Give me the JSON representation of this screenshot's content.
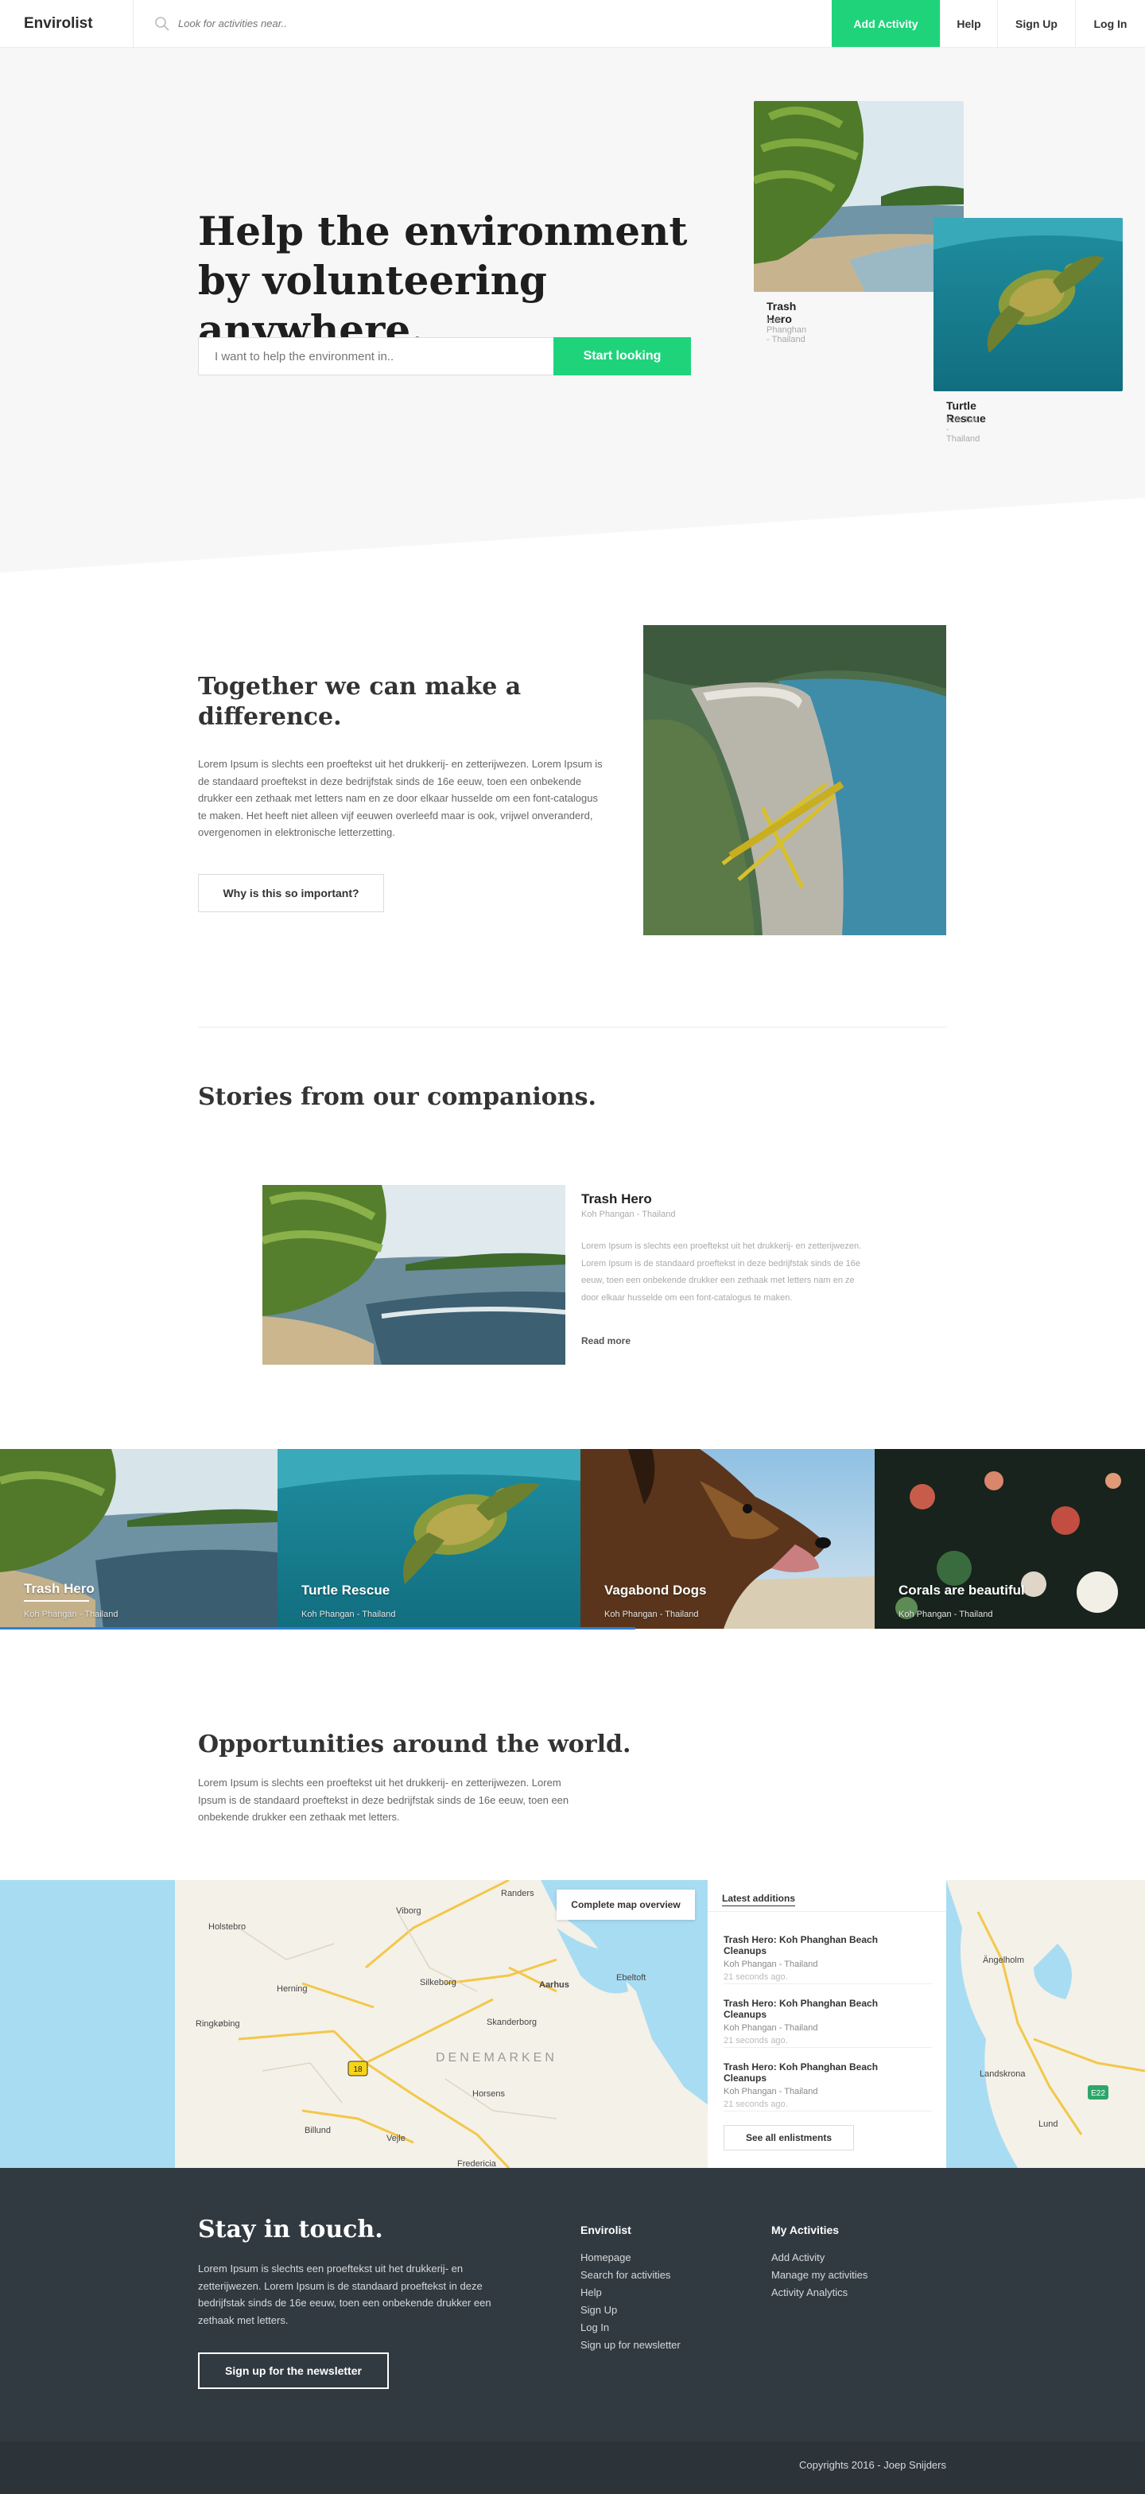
{
  "nav": {
    "brand": "Envirolist",
    "search_placeholder": "Look for activities near..",
    "add_activity": "Add Activity",
    "help": "Help",
    "sign_up": "Sign Up",
    "log_in": "Log In"
  },
  "hero": {
    "title": "Help the environment by volunteering anywhere.",
    "input_placeholder": "I want to help the environment in..",
    "button": "Start looking",
    "cards": [
      {
        "title": "Trash Hero",
        "location": "Koh Phanghan - Thailand"
      },
      {
        "title": "Turtle Rescue",
        "location": "Koh Tao - Thailand"
      }
    ]
  },
  "together": {
    "title": "Together we can make a difference.",
    "text": "Lorem Ipsum is slechts een proeftekst uit het drukkerij- en zetterijwezen. Lorem Ipsum is de standaard proeftekst in deze bedrijfstak sinds de 16e eeuw, toen een onbekende drukker een zethaak met letters nam en ze door elkaar husselde om een font-catalogus te maken. Het heeft niet alleen vijf eeuwen overleefd maar is ook, vrijwel onveranderd, overgenomen in elektronische letterzetting.",
    "button": "Why is this so important?"
  },
  "stories": {
    "title": "Stories from our companions.",
    "featured": {
      "title": "Trash Hero",
      "location": "Koh Phangan - Thailand",
      "text": "Lorem Ipsum is slechts een proeftekst uit het drukkerij- en zetterijwezen. Lorem Ipsum is de standaard proeftekst in deze bedrijfstak sinds de 16e eeuw, toen een onbekende drukker een zethaak met letters nam en ze door elkaar husselde om een font-catalogus te maken.",
      "read_more": "Read more"
    },
    "tiles": [
      {
        "title": "Trash Hero",
        "location": "Koh Phangan - Thailand"
      },
      {
        "title": "Turtle Rescue",
        "location": "Koh Phangan - Thailand"
      },
      {
        "title": "Vagabond Dogs",
        "location": "Koh Phangan - Thailand"
      },
      {
        "title": "Corals are beautiful",
        "location": "Koh Phangan - Thailand"
      }
    ]
  },
  "opportunities": {
    "title": "Opportunities around the world.",
    "text": "Lorem Ipsum is slechts een proeftekst uit het drukkerij- en zetterijwezen. Lorem Ipsum is de standaard proeftekst in deze bedrijfstak sinds de 16e eeuw, toen een onbekende drukker een zethaak met letters.",
    "map_button": "Complete map overview",
    "map_labels": {
      "randers": "Randers",
      "viborg": "Viborg",
      "holstebro": "Holstebro",
      "herning": "Herning",
      "silkeborg": "Silkeborg",
      "aarhus": "Aarhus",
      "ebeltoft": "Ebeltoft",
      "ringkobing": "Ringkøbing",
      "skanderborg": "Skanderborg",
      "denemarken": "DENEMARKEN",
      "horsens": "Horsens",
      "billund": "Billund",
      "vejle": "Vejle",
      "fredericia": "Fredericia",
      "road18": "18",
      "angelholm": "Ängelholm",
      "landskrona": "Landskrona",
      "lund": "Lund",
      "e22": "E22"
    },
    "latest": {
      "heading": "Latest additions",
      "items": [
        {
          "title": "Trash Hero: Koh Phanghan Beach Cleanups",
          "location": "Koh Phangan - Thailand",
          "time": "21 seconds ago."
        },
        {
          "title": "Trash Hero: Koh Phanghan Beach Cleanups",
          "location": "Koh Phangan - Thailand",
          "time": "21 seconds ago."
        },
        {
          "title": "Trash Hero: Koh Phanghan Beach Cleanups",
          "location": "Koh Phangan - Thailand",
          "time": "21 seconds ago."
        }
      ],
      "see_all": "See all enlistments"
    }
  },
  "footer": {
    "title": "Stay in touch.",
    "text": "Lorem Ipsum is slechts een proeftekst uit het drukkerij- en zetterijwezen. Lorem Ipsum is de standaard proeftekst in deze bedrijfstak sinds de 16e eeuw, toen een onbekende drukker een zethaak met letters.",
    "button": "Sign up for the newsletter",
    "col1": {
      "heading": "Envirolist",
      "links": [
        "Homepage",
        "Search for activities",
        "Help",
        "Sign Up",
        "Log In",
        "Sign up for newsletter"
      ]
    },
    "col2": {
      "heading": "My Activities",
      "links": [
        "Add Activity",
        "Manage my activities",
        "Activity Analytics"
      ]
    },
    "copyright": "Copyrights 2016 - Joep Snijders"
  },
  "colors": {
    "accent": "#1fd37b",
    "footer": "#323a41",
    "hero_bg": "#f7f7f7",
    "progress": "#2e7fd0"
  },
  "slider_progress": 0.555
}
